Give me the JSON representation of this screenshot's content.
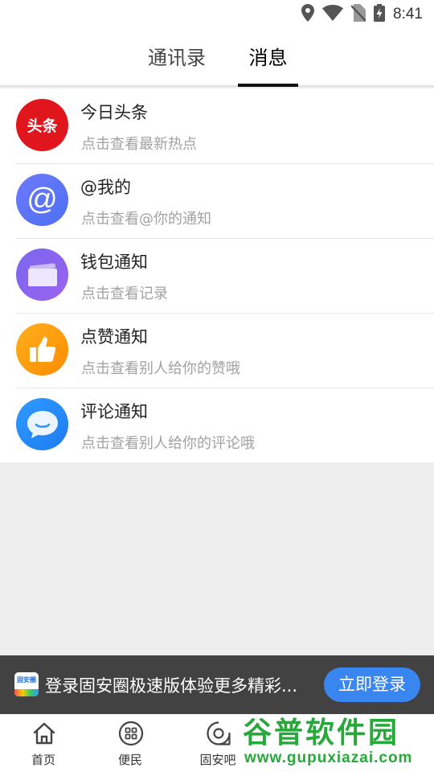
{
  "status_bar": {
    "time": "8:41",
    "icons": [
      "location-icon",
      "wifi-icon",
      "no-sim-icon",
      "battery-charging-icon"
    ]
  },
  "tabs": [
    {
      "label": "通讯录",
      "active": false
    },
    {
      "label": "消息",
      "active": true
    }
  ],
  "messages": [
    {
      "icon": "toutiao-icon",
      "icon_text": "头条",
      "title": "今日头条",
      "subtitle": "点击查看最新热点",
      "color": "#e0161c"
    },
    {
      "icon": "at-icon",
      "icon_text": "@",
      "title": "@我的",
      "subtitle": "点击查看@你的通知",
      "color": "#5b74f5"
    },
    {
      "icon": "wallet-icon",
      "title": "钱包通知",
      "subtitle": "点击查看记录",
      "color": "#8a64ef"
    },
    {
      "icon": "thumbs-up-icon",
      "title": "点赞通知",
      "subtitle": "点击查看别人给你的赞哦",
      "color": "#fd9b10"
    },
    {
      "icon": "comment-icon",
      "title": "评论通知",
      "subtitle": "点击查看别人给你的评论哦",
      "color": "#278cf7"
    }
  ],
  "banner": {
    "logo_text": "固安圈",
    "text": "登录固安圈极速版体验更多精彩...",
    "button_label": "立即登录",
    "button_color": "#3a86f0"
  },
  "bottom_nav": [
    {
      "label": "首页",
      "icon": "home-icon"
    },
    {
      "label": "便民",
      "icon": "grid-icon"
    },
    {
      "label": "固安吧",
      "icon": "chat-circle-icon"
    }
  ],
  "watermark": {
    "title": "谷普软件园",
    "url": "www.gupuxiazai.com"
  }
}
